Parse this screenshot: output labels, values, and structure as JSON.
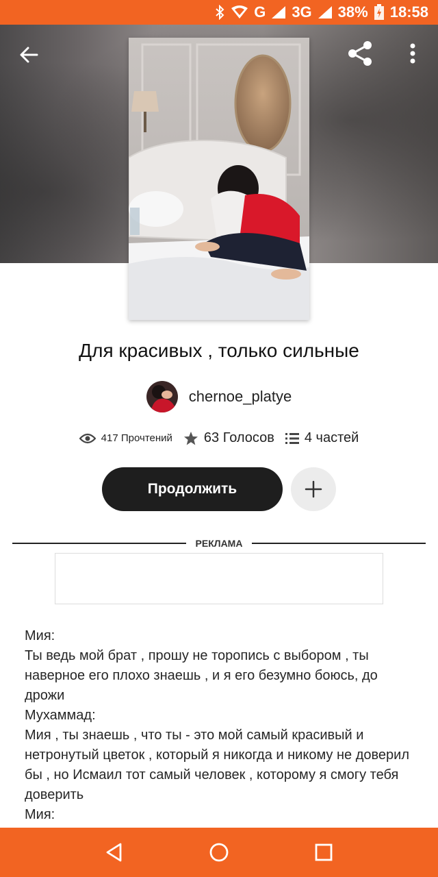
{
  "status_bar": {
    "network_3g": "3G",
    "network_g": "G",
    "battery": "38%",
    "time": "18:58"
  },
  "header": {
    "back_icon": "arrow-left-icon",
    "share_icon": "share-icon",
    "more_icon": "more-vertical-icon"
  },
  "story": {
    "title": "Для красивых , только сильные",
    "author": "chernoe_platye",
    "reads": "417 Прочтений",
    "votes": "63 Голосов",
    "parts": "4 частей"
  },
  "actions": {
    "continue_label": "Продолжить",
    "add_icon": "plus-icon"
  },
  "ad": {
    "label": "РЕКЛАМА"
  },
  "body_lines": [
    "Мия:",
    "Ты ведь мой брат , прошу не торопись с выбором , ты наверное его плохо знаешь   , и я его безумно  боюсь, до дрожи",
    "Мухаммад:",
    "Мия , ты знаешь , что ты - это мой самый красивый и нетронутый  цветок , который я никогда и никому не доверил бы , но Исмаил тот самый человек , которому я смогу тебя доверить",
    "Мия:"
  ],
  "colors": {
    "accent": "#f26422",
    "button_dark": "#1e1e1e",
    "add_button_bg": "#ececec"
  }
}
